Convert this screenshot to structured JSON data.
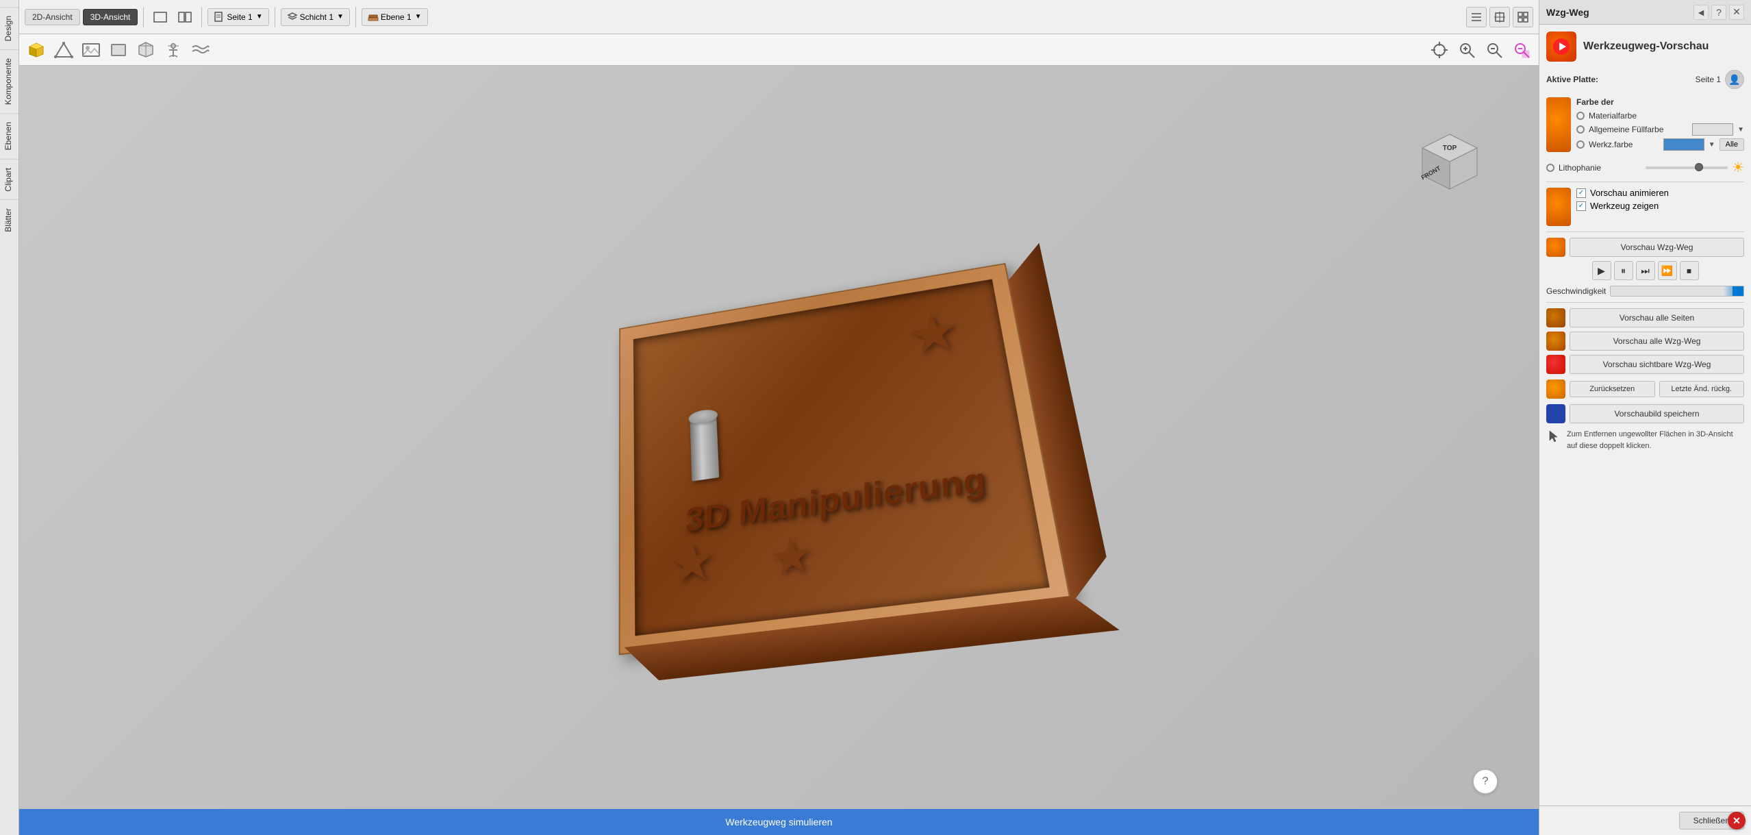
{
  "app": {
    "left_tabs": [
      "Design",
      "Komponente",
      "Ebenen",
      "Clipart",
      "Blätter"
    ],
    "toolbar": {
      "view_2d": "2D-Ansicht",
      "view_3d": "3D-Ansicht",
      "page_label": "Seite 1",
      "layer_label": "Schicht 1",
      "level_label": "Ebene 1"
    },
    "status_bar": "Werkzeugweg simulieren"
  },
  "panel": {
    "title": "Wzg-Weg",
    "header_icons": [
      "◄",
      "?",
      "✕"
    ],
    "preview_title": "Werkzeugweg-Vorschau",
    "aktive_platte_label": "Aktive Platte:",
    "aktive_platte_value": "Seite 1",
    "farbe_section": "Farbe der",
    "color_options": [
      {
        "label": "Materialfarbe",
        "checked": false
      },
      {
        "label": "Allgemeine Füllfarbe",
        "checked": false
      },
      {
        "label": "Werkz.farbe",
        "checked": false
      },
      {
        "label": "Lithophanie",
        "checked": false
      }
    ],
    "alle_btn": "Alle",
    "checkbox_options": [
      {
        "label": "Vorschau animieren",
        "checked": true
      },
      {
        "label": "Werkzeug zeigen",
        "checked": true
      }
    ],
    "vorschau_wzg_weg_btn": "Vorschau Wzg-Weg",
    "playback_btns": [
      "▶",
      "⏸",
      "⏭",
      "⏩",
      "⏹"
    ],
    "geschwindigkeit_label": "Geschwindigkeit",
    "vorschau_alle_seiten": "Vorschau alle Seiten",
    "vorschau_alle_wzg": "Vorschau alle Wzg-Weg",
    "vorschau_sichtbare": "Vorschau sichtbare Wzg-Weg",
    "zuruecksetzen": "Zurücksetzen",
    "letzte_aend": "Letzte Änd. rückg.",
    "vorschaubild": "Vorschaubild speichern",
    "info_text": "Zum Entfernen ungewollter Flächen in 3D-Ansicht auf diese doppelt klicken.",
    "schliessen": "Schließen"
  },
  "viewport": {
    "nav_cube_labels": {
      "top": "TOP",
      "front": "FRONT"
    },
    "board_text": "3D Manipulierung"
  }
}
